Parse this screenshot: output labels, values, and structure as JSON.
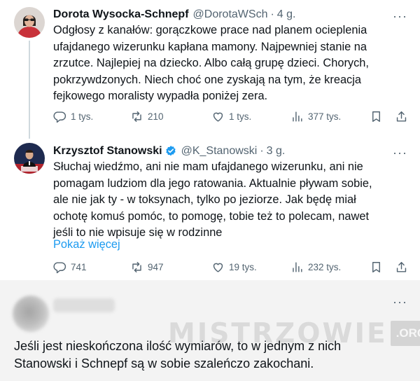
{
  "tweets": [
    {
      "name": "Dorota Wysocka-Schnepf",
      "handle": "@DorotaWSch",
      "separator": "·",
      "time": "4 g.",
      "more": "···",
      "lines": [
        "Odgłosy z kanałów: gorączkowe prace nad planem ocieplenia",
        "ufajdanego wizerunku kapłana mamony. Najpewniej stanie na",
        "zrzutce. Najlepiej na dziecko. Albo całą grupę dzieci. Chorych,",
        "pokrzywdzonych. Niech choć one zyskają na tym, że kreacja",
        "fejkowego moralisty wypadła poniżej zera."
      ],
      "stats": {
        "replies": "1 tys.",
        "reposts": "210",
        "likes": "1 tys.",
        "views": "377 tys."
      }
    },
    {
      "name": "Krzysztof Stanowski",
      "verified": true,
      "handle": "@K_Stanowski",
      "separator": "·",
      "time": "3 g.",
      "more": "···",
      "lines": [
        "Słuchaj wiedźmo, ani nie mam ufajdanego wizerunku, ani nie",
        "pomagam ludziom dla jego ratowania. Aktualnie pływam sobie,",
        "ale nie jak ty - w toksynach, tylko po jeziorze. Jak będę miał",
        "ochotę komuś pomóc, to pomogę, tobie też to polecam, nawet",
        "jeśli to nie wpisuje się w rodzinne"
      ],
      "show_more": "Pokaż więcej",
      "stats": {
        "replies": "741",
        "reposts": "947",
        "likes": "19 tys.",
        "views": "232 tys."
      }
    }
  ],
  "third_post": {
    "more": "···",
    "lines": [
      "Jeśli jest nieskończona ilość wymiarów, to w jednym z nich",
      "Stanowski i Schnepf są w sobie szaleńczo zakochani."
    ]
  },
  "watermark": {
    "text": "MISTRZOWIE",
    "suffix": ".ORG"
  },
  "colors": {
    "accent": "#1d9bf0",
    "muted": "#536471",
    "text": "#0f1419",
    "thread_line": "#cfd9de"
  },
  "icons": [
    "reply-icon",
    "repost-icon",
    "like-icon",
    "views-icon",
    "bookmark-icon",
    "share-icon",
    "verified-badge-icon"
  ]
}
